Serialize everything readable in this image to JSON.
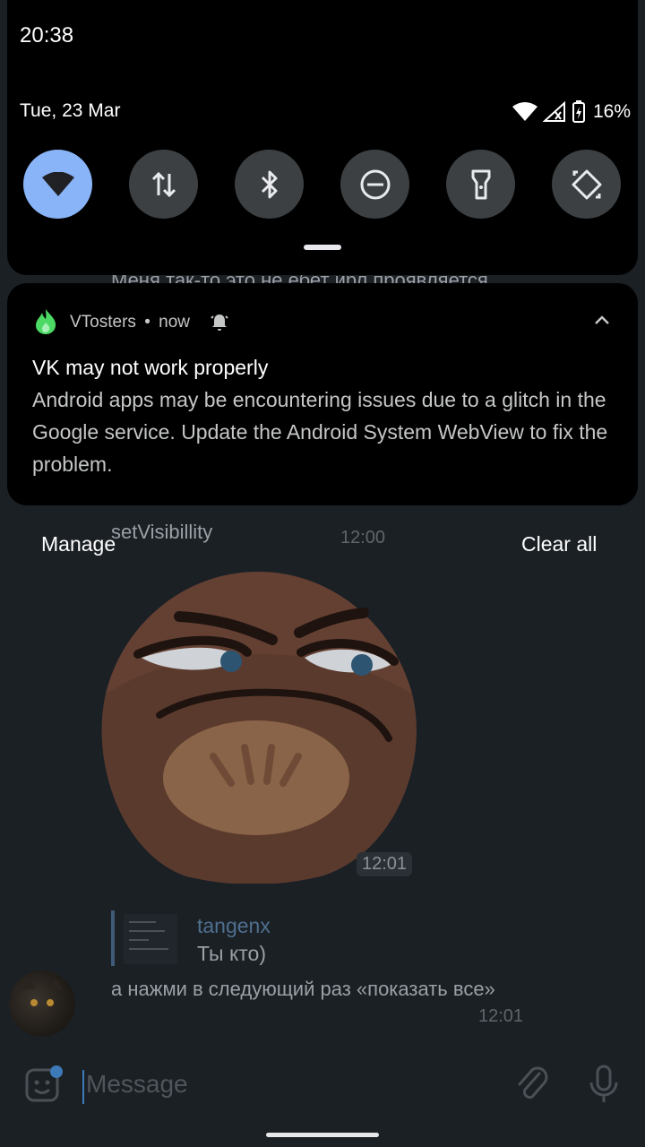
{
  "status_bar": {
    "time": "20:38",
    "date": "Tue, 23 Mar",
    "battery": "16%"
  },
  "quick_settings": {
    "tiles": [
      {
        "name": "wifi",
        "icon": "wifi-icon",
        "active": true
      },
      {
        "name": "mobile-data",
        "icon": "mobile-data-icon",
        "active": false
      },
      {
        "name": "bluetooth",
        "icon": "bluetooth-icon",
        "active": false
      },
      {
        "name": "do-not-disturb",
        "icon": "dnd-icon",
        "active": false
      },
      {
        "name": "flashlight",
        "icon": "flashlight-icon",
        "active": false
      },
      {
        "name": "auto-rotate",
        "icon": "rotate-icon",
        "active": false
      }
    ],
    "accent_color": "#8ab4f8"
  },
  "notification": {
    "app_name": "VTosters",
    "separator": "•",
    "time": "now",
    "title": "VK may not work properly",
    "body": "Android apps may be encountering issues due to a glitch in the Google service. Update the Android System WebView to fix the problem.",
    "app_icon_color": "#4cd964"
  },
  "actions": {
    "manage": "Manage",
    "clear_all": "Clear all"
  },
  "chat": {
    "partial_message": "Меня так-то это не ебет ирл проявляется",
    "message1_text": "setVisibillity",
    "message1_time": "12:00",
    "sticker_time": "12:01",
    "reply_author": "tangenx",
    "reply_text": "Ты кто)",
    "message2_text": "а нажми в следующий раз «показать все»",
    "message2_time": "12:01",
    "input_placeholder": "Message"
  }
}
